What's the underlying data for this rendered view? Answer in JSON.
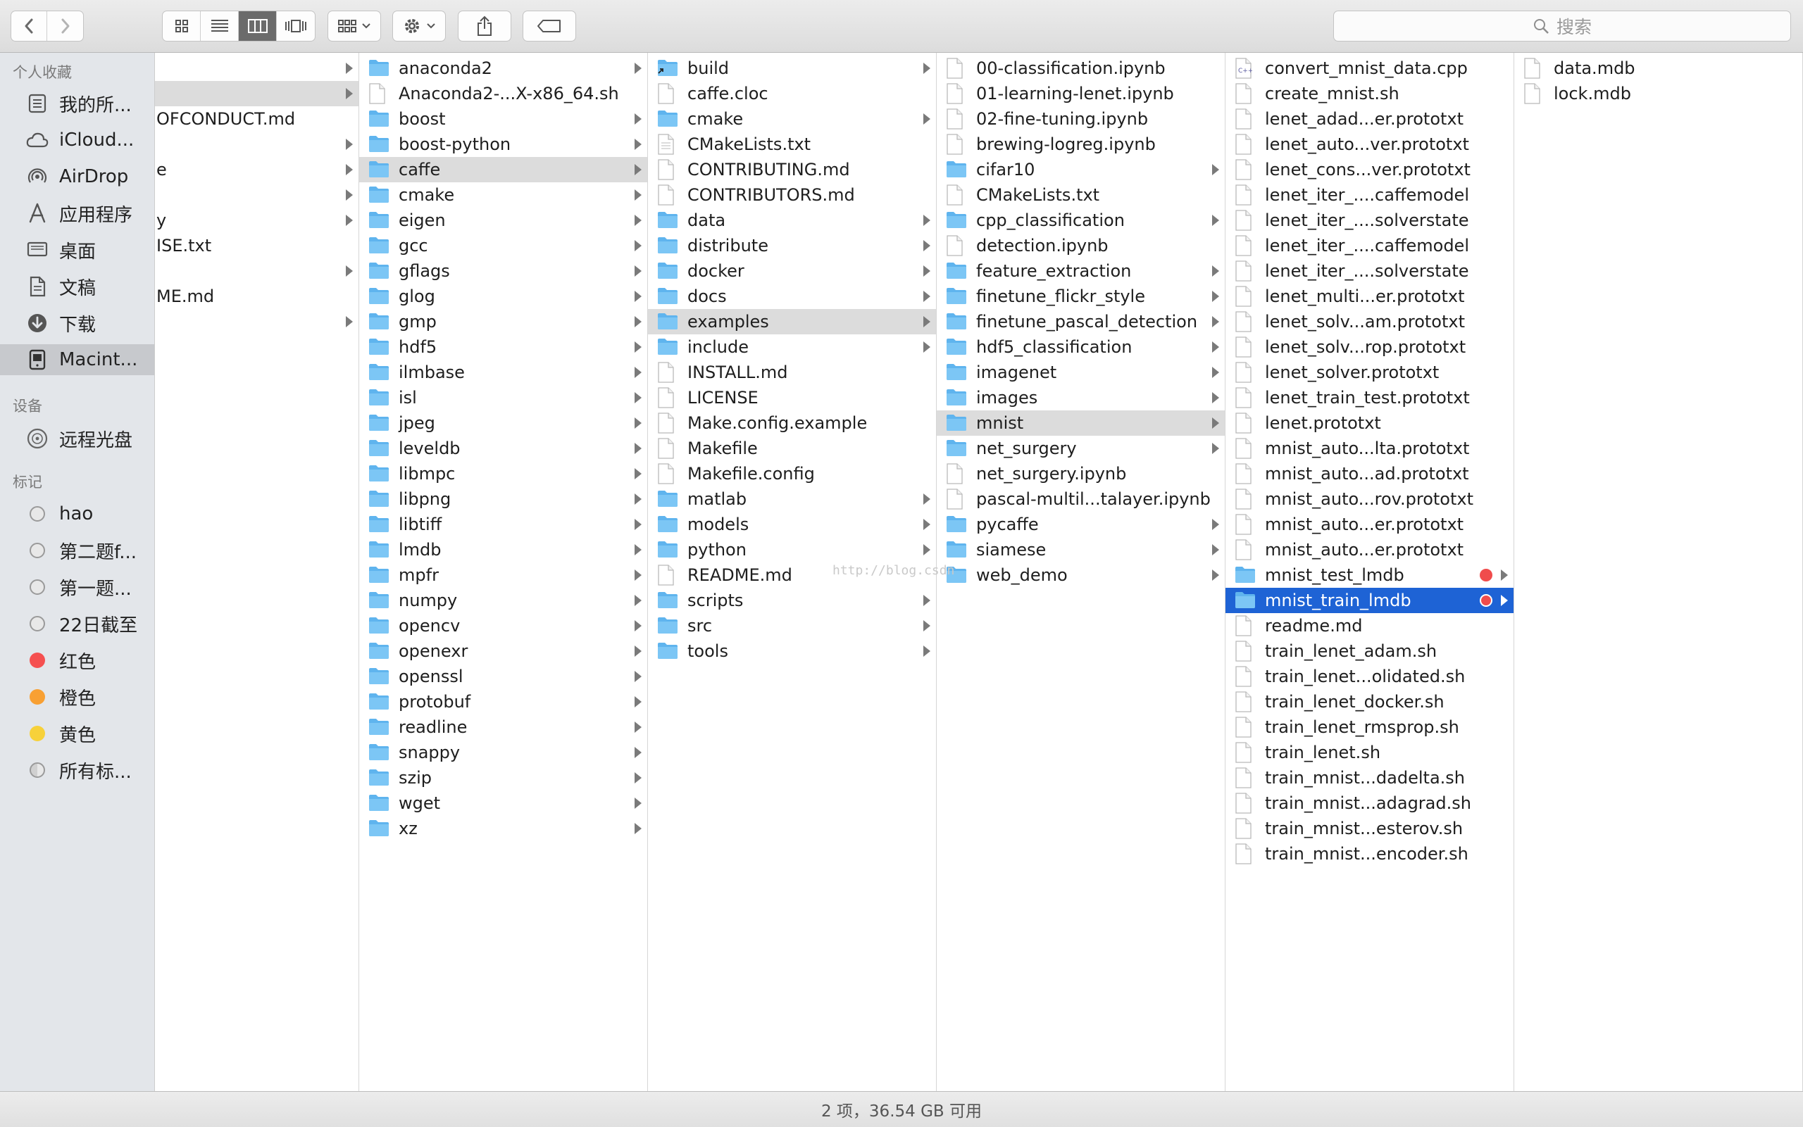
{
  "toolbar": {
    "search_placeholder": "搜索"
  },
  "sidebar": {
    "favorites_header": "个人收藏",
    "favorites": [
      {
        "label": "我的所...",
        "icon": "all-files-icon"
      },
      {
        "label": "iCloud...",
        "icon": "cloud-icon"
      },
      {
        "label": "AirDrop",
        "icon": "airdrop-icon"
      },
      {
        "label": "应用程序",
        "icon": "applications-icon"
      },
      {
        "label": "桌面",
        "icon": "desktop-icon"
      },
      {
        "label": "文稿",
        "icon": "documents-icon"
      },
      {
        "label": "下载",
        "icon": "downloads-icon"
      },
      {
        "label": "Macint...",
        "icon": "hard-drive-icon",
        "selected": true
      }
    ],
    "devices_header": "设备",
    "devices": [
      {
        "label": "远程光盘",
        "icon": "remote-disc-icon"
      }
    ],
    "tags_header": "标记",
    "tags": [
      {
        "label": "hao",
        "color": "#e8e8e8"
      },
      {
        "label": "第二题f...",
        "color": "#e8e8e8"
      },
      {
        "label": "第一题...",
        "color": "#e8e8e8"
      },
      {
        "label": "22日截至",
        "color": "#e8e8e8"
      },
      {
        "label": "红色",
        "color": "#f55050"
      },
      {
        "label": "橙色",
        "color": "#f8a033"
      },
      {
        "label": "黄色",
        "color": "#f7d13a"
      },
      {
        "label": "所有标...",
        "color": "all"
      }
    ]
  },
  "columns": [
    {
      "rows": [
        {
          "name": "",
          "type": "folder",
          "arrow": true,
          "hidden_icon": true
        },
        {
          "name": "",
          "type": "folder",
          "arrow": true,
          "hidden_icon": true,
          "highlight": true
        },
        {
          "name": "OFCONDUCT.md",
          "type": "file",
          "hidden_icon": true
        },
        {
          "name": "",
          "type": "folder",
          "arrow": true,
          "hidden_icon": true
        },
        {
          "name": "e",
          "type": "folder",
          "arrow": true,
          "hidden_icon": true
        },
        {
          "name": "",
          "type": "folder",
          "arrow": true,
          "hidden_icon": true
        },
        {
          "name": "y",
          "type": "folder",
          "arrow": true,
          "hidden_icon": true
        },
        {
          "name": "ISE.txt",
          "type": "file",
          "hidden_icon": true
        },
        {
          "name": "",
          "type": "folder",
          "arrow": true,
          "hidden_icon": true
        },
        {
          "name": "ME.md",
          "type": "file",
          "hidden_icon": true
        },
        {
          "name": "",
          "type": "folder",
          "arrow": true,
          "hidden_icon": true
        }
      ]
    },
    {
      "rows": [
        {
          "name": "anaconda2",
          "type": "folder",
          "arrow": true
        },
        {
          "name": "Anaconda2-...X-x86_64.sh",
          "type": "file"
        },
        {
          "name": "boost",
          "type": "folder",
          "arrow": true
        },
        {
          "name": "boost-python",
          "type": "folder",
          "arrow": true
        },
        {
          "name": "caffe",
          "type": "folder",
          "arrow": true,
          "highlight": true
        },
        {
          "name": "cmake",
          "type": "folder",
          "arrow": true
        },
        {
          "name": "eigen",
          "type": "folder",
          "arrow": true
        },
        {
          "name": "gcc",
          "type": "folder",
          "arrow": true
        },
        {
          "name": "gflags",
          "type": "folder",
          "arrow": true
        },
        {
          "name": "glog",
          "type": "folder",
          "arrow": true
        },
        {
          "name": "gmp",
          "type": "folder",
          "arrow": true
        },
        {
          "name": "hdf5",
          "type": "folder",
          "arrow": true
        },
        {
          "name": "ilmbase",
          "type": "folder",
          "arrow": true
        },
        {
          "name": "isl",
          "type": "folder",
          "arrow": true
        },
        {
          "name": "jpeg",
          "type": "folder",
          "arrow": true
        },
        {
          "name": "leveldb",
          "type": "folder",
          "arrow": true
        },
        {
          "name": "libmpc",
          "type": "folder",
          "arrow": true
        },
        {
          "name": "libpng",
          "type": "folder",
          "arrow": true
        },
        {
          "name": "libtiff",
          "type": "folder",
          "arrow": true
        },
        {
          "name": "lmdb",
          "type": "folder",
          "arrow": true
        },
        {
          "name": "mpfr",
          "type": "folder",
          "arrow": true
        },
        {
          "name": "numpy",
          "type": "folder",
          "arrow": true
        },
        {
          "name": "opencv",
          "type": "folder",
          "arrow": true
        },
        {
          "name": "openexr",
          "type": "folder",
          "arrow": true
        },
        {
          "name": "openssl",
          "type": "folder",
          "arrow": true
        },
        {
          "name": "protobuf",
          "type": "folder",
          "arrow": true
        },
        {
          "name": "readline",
          "type": "folder",
          "arrow": true
        },
        {
          "name": "snappy",
          "type": "folder",
          "arrow": true
        },
        {
          "name": "szip",
          "type": "folder",
          "arrow": true
        },
        {
          "name": "wget",
          "type": "folder",
          "arrow": true
        },
        {
          "name": "xz",
          "type": "folder",
          "arrow": true
        }
      ]
    },
    {
      "rows": [
        {
          "name": "build",
          "type": "alias",
          "arrow": true
        },
        {
          "name": "caffe.cloc",
          "type": "file"
        },
        {
          "name": "cmake",
          "type": "folder",
          "arrow": true
        },
        {
          "name": "CMakeLists.txt",
          "type": "textfile"
        },
        {
          "name": "CONTRIBUTING.md",
          "type": "file"
        },
        {
          "name": "CONTRIBUTORS.md",
          "type": "file"
        },
        {
          "name": "data",
          "type": "folder",
          "arrow": true
        },
        {
          "name": "distribute",
          "type": "folder",
          "arrow": true
        },
        {
          "name": "docker",
          "type": "folder",
          "arrow": true
        },
        {
          "name": "docs",
          "type": "folder",
          "arrow": true
        },
        {
          "name": "examples",
          "type": "folder",
          "arrow": true,
          "highlight": true
        },
        {
          "name": "include",
          "type": "folder",
          "arrow": true
        },
        {
          "name": "INSTALL.md",
          "type": "file"
        },
        {
          "name": "LICENSE",
          "type": "file"
        },
        {
          "name": "Make.config.example",
          "type": "file"
        },
        {
          "name": "Makefile",
          "type": "file"
        },
        {
          "name": "Makefile.config",
          "type": "file"
        },
        {
          "name": "matlab",
          "type": "folder",
          "arrow": true
        },
        {
          "name": "models",
          "type": "folder",
          "arrow": true
        },
        {
          "name": "python",
          "type": "folder",
          "arrow": true
        },
        {
          "name": "README.md",
          "type": "file"
        },
        {
          "name": "scripts",
          "type": "folder",
          "arrow": true
        },
        {
          "name": "src",
          "type": "folder",
          "arrow": true
        },
        {
          "name": "tools",
          "type": "folder",
          "arrow": true
        }
      ]
    },
    {
      "rows": [
        {
          "name": "00-classification.ipynb",
          "type": "file"
        },
        {
          "name": "01-learning-lenet.ipynb",
          "type": "file"
        },
        {
          "name": "02-fine-tuning.ipynb",
          "type": "file"
        },
        {
          "name": "brewing-logreg.ipynb",
          "type": "file"
        },
        {
          "name": "cifar10",
          "type": "folder",
          "arrow": true
        },
        {
          "name": "CMakeLists.txt",
          "type": "file"
        },
        {
          "name": "cpp_classification",
          "type": "folder",
          "arrow": true
        },
        {
          "name": "detection.ipynb",
          "type": "file"
        },
        {
          "name": "feature_extraction",
          "type": "folder",
          "arrow": true
        },
        {
          "name": "finetune_flickr_style",
          "type": "folder",
          "arrow": true
        },
        {
          "name": "finetune_pascal_detection",
          "type": "folder",
          "arrow": true
        },
        {
          "name": "hdf5_classification",
          "type": "folder",
          "arrow": true
        },
        {
          "name": "imagenet",
          "type": "folder",
          "arrow": true
        },
        {
          "name": "images",
          "type": "folder",
          "arrow": true
        },
        {
          "name": "mnist",
          "type": "folder",
          "arrow": true,
          "highlight": true
        },
        {
          "name": "net_surgery",
          "type": "folder",
          "arrow": true
        },
        {
          "name": "net_surgery.ipynb",
          "type": "file"
        },
        {
          "name": "pascal-multil...talayer.ipynb",
          "type": "file"
        },
        {
          "name": "pycaffe",
          "type": "folder",
          "arrow": true
        },
        {
          "name": "siamese",
          "type": "folder",
          "arrow": true
        },
        {
          "name": "web_demo",
          "type": "folder",
          "arrow": true
        }
      ]
    },
    {
      "rows": [
        {
          "name": "convert_mnist_data.cpp",
          "type": "cppfile"
        },
        {
          "name": "create_mnist.sh",
          "type": "file"
        },
        {
          "name": "lenet_adad...er.prototxt",
          "type": "file"
        },
        {
          "name": "lenet_auto...ver.prototxt",
          "type": "file"
        },
        {
          "name": "lenet_cons...ver.prototxt",
          "type": "file"
        },
        {
          "name": "lenet_iter_....caffemodel",
          "type": "file"
        },
        {
          "name": "lenet_iter_....solverstate",
          "type": "file"
        },
        {
          "name": "lenet_iter_....caffemodel",
          "type": "file"
        },
        {
          "name": "lenet_iter_....solverstate",
          "type": "file"
        },
        {
          "name": "lenet_multi...er.prototxt",
          "type": "file"
        },
        {
          "name": "lenet_solv...am.prototxt",
          "type": "file"
        },
        {
          "name": "lenet_solv...rop.prototxt",
          "type": "file"
        },
        {
          "name": "lenet_solver.prototxt",
          "type": "file"
        },
        {
          "name": "lenet_train_test.prototxt",
          "type": "file"
        },
        {
          "name": "lenet.prototxt",
          "type": "file"
        },
        {
          "name": "mnist_auto...lta.prototxt",
          "type": "file"
        },
        {
          "name": "mnist_auto...ad.prototxt",
          "type": "file"
        },
        {
          "name": "mnist_auto...rov.prototxt",
          "type": "file"
        },
        {
          "name": "mnist_auto...er.prototxt",
          "type": "file"
        },
        {
          "name": "mnist_auto...er.prototxt",
          "type": "file"
        },
        {
          "name": "mnist_test_lmdb",
          "type": "folder",
          "arrow": true,
          "red_tag": true
        },
        {
          "name": "mnist_train_lmdb",
          "type": "folder",
          "arrow": true,
          "red_tag": true,
          "selected": true
        },
        {
          "name": "readme.md",
          "type": "file"
        },
        {
          "name": "train_lenet_adam.sh",
          "type": "file"
        },
        {
          "name": "train_lenet...olidated.sh",
          "type": "file"
        },
        {
          "name": "train_lenet_docker.sh",
          "type": "file"
        },
        {
          "name": "train_lenet_rmsprop.sh",
          "type": "file"
        },
        {
          "name": "train_lenet.sh",
          "type": "file"
        },
        {
          "name": "train_mnist...dadelta.sh",
          "type": "file"
        },
        {
          "name": "train_mnist...adagrad.sh",
          "type": "file"
        },
        {
          "name": "train_mnist...esterov.sh",
          "type": "file"
        },
        {
          "name": "train_mnist...encoder.sh",
          "type": "file"
        }
      ]
    },
    {
      "rows": [
        {
          "name": "data.mdb",
          "type": "file"
        },
        {
          "name": "lock.mdb",
          "type": "file"
        }
      ]
    }
  ],
  "watermark": "http://blog.csdn",
  "status": {
    "text": "2 项，36.54 GB 可用"
  }
}
